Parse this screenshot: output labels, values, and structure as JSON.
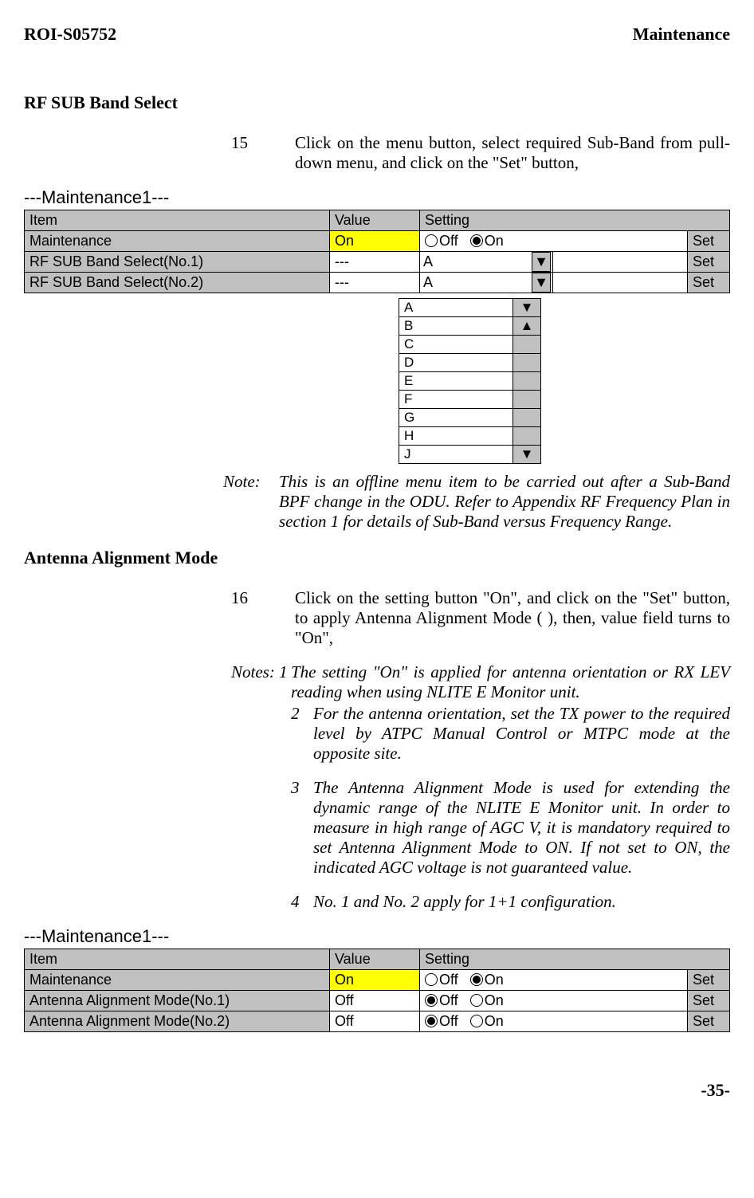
{
  "header": {
    "doc_id": "ROI-S05752",
    "section": "Maintenance"
  },
  "rf_sub": {
    "title": "RF SUB Band Select",
    "step_num": "15",
    "step_text": "Click on the menu button, select required Sub-Band from pull-down menu, and click on the \"Set\" button,",
    "note_label": "Note:",
    "note_text": "This is an offline menu item to be carried out after a Sub-Band BPF change in the ODU. Refer to Appendix RF Frequency Plan in section 1 for details of Sub-Band versus Frequency Range."
  },
  "maint_block1": {
    "title": "---Maintenance1---",
    "cols": {
      "item": "Item",
      "value": "Value",
      "setting": "Setting"
    },
    "rows": [
      {
        "item": "Maintenance",
        "value": "On",
        "radio_off": "Off",
        "radio_on": "On",
        "set": "Set",
        "type": "radio",
        "value_class": "val-on"
      },
      {
        "item": "RF SUB Band Select(No.1)",
        "value": "---",
        "dd": "A",
        "set": "Set",
        "type": "dd"
      },
      {
        "item": "RF SUB Band Select(No.2)",
        "value": "---",
        "dd": "A",
        "set": "Set",
        "type": "dd"
      }
    ]
  },
  "dropdown_popup": {
    "options": [
      "A",
      "B",
      "C",
      "D",
      "E",
      "F",
      "G",
      "H",
      "J"
    ],
    "arrow_down": "▼",
    "arrow_up": "▲"
  },
  "antenna": {
    "title": "Antenna Alignment Mode",
    "step_num": "16",
    "step_text": "Click on the setting button \"On\", and click on the \"Set\" button, to apply Antenna Alignment Mode ( ), then, value field turns to \"On\",",
    "notes_lead": "Notes: 1",
    "notes": [
      "The setting \"On\" is applied for antenna orientation or RX LEV reading when using NLITE E  Monitor unit.",
      "For the antenna orientation, set the TX power to the required level by ATPC Manual Control or MTPC mode at the opposite site.",
      "The Antenna Alignment Mode is used for extending the dynamic range of the NLITE E Monitor unit. In order to measure in high range of AGC V, it is mandatory required to set Antenna Alignment Mode to ON. If not set to ON, the indicated AGC voltage is not guaranteed value.",
      "No. 1 and No. 2 apply for 1+1 configuration."
    ],
    "note_nums": [
      "1",
      "2",
      "3",
      "4"
    ]
  },
  "maint_block2": {
    "title": "---Maintenance1---",
    "cols": {
      "item": "Item",
      "value": "Value",
      "setting": "Setting"
    },
    "rows": [
      {
        "item": "Maintenance",
        "value": "On",
        "radio_off": "Off",
        "radio_on": "On",
        "sel": "on",
        "set": "Set",
        "value_class": "val-on"
      },
      {
        "item": "Antenna Alignment Mode(No.1)",
        "value": "Off",
        "radio_off": "Off",
        "radio_on": "On",
        "sel": "off",
        "set": "Set",
        "value_class": ""
      },
      {
        "item": "Antenna Alignment Mode(No.2)",
        "value": "Off",
        "radio_off": "Off",
        "radio_on": "On",
        "sel": "off",
        "set": "Set",
        "value_class": ""
      }
    ]
  },
  "page_num": "-35-"
}
